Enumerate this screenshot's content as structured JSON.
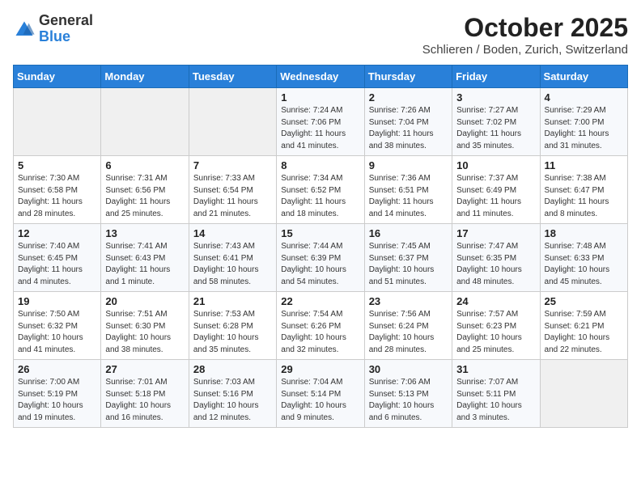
{
  "header": {
    "logo_general": "General",
    "logo_blue": "Blue",
    "title": "October 2025",
    "subtitle": "Schlieren / Boden, Zurich, Switzerland"
  },
  "calendar": {
    "days_of_week": [
      "Sunday",
      "Monday",
      "Tuesday",
      "Wednesday",
      "Thursday",
      "Friday",
      "Saturday"
    ],
    "weeks": [
      [
        {
          "day": "",
          "info": ""
        },
        {
          "day": "",
          "info": ""
        },
        {
          "day": "",
          "info": ""
        },
        {
          "day": "1",
          "info": "Sunrise: 7:24 AM\nSunset: 7:06 PM\nDaylight: 11 hours and 41 minutes."
        },
        {
          "day": "2",
          "info": "Sunrise: 7:26 AM\nSunset: 7:04 PM\nDaylight: 11 hours and 38 minutes."
        },
        {
          "day": "3",
          "info": "Sunrise: 7:27 AM\nSunset: 7:02 PM\nDaylight: 11 hours and 35 minutes."
        },
        {
          "day": "4",
          "info": "Sunrise: 7:29 AM\nSunset: 7:00 PM\nDaylight: 11 hours and 31 minutes."
        }
      ],
      [
        {
          "day": "5",
          "info": "Sunrise: 7:30 AM\nSunset: 6:58 PM\nDaylight: 11 hours and 28 minutes."
        },
        {
          "day": "6",
          "info": "Sunrise: 7:31 AM\nSunset: 6:56 PM\nDaylight: 11 hours and 25 minutes."
        },
        {
          "day": "7",
          "info": "Sunrise: 7:33 AM\nSunset: 6:54 PM\nDaylight: 11 hours and 21 minutes."
        },
        {
          "day": "8",
          "info": "Sunrise: 7:34 AM\nSunset: 6:52 PM\nDaylight: 11 hours and 18 minutes."
        },
        {
          "day": "9",
          "info": "Sunrise: 7:36 AM\nSunset: 6:51 PM\nDaylight: 11 hours and 14 minutes."
        },
        {
          "day": "10",
          "info": "Sunrise: 7:37 AM\nSunset: 6:49 PM\nDaylight: 11 hours and 11 minutes."
        },
        {
          "day": "11",
          "info": "Sunrise: 7:38 AM\nSunset: 6:47 PM\nDaylight: 11 hours and 8 minutes."
        }
      ],
      [
        {
          "day": "12",
          "info": "Sunrise: 7:40 AM\nSunset: 6:45 PM\nDaylight: 11 hours and 4 minutes."
        },
        {
          "day": "13",
          "info": "Sunrise: 7:41 AM\nSunset: 6:43 PM\nDaylight: 11 hours and 1 minute."
        },
        {
          "day": "14",
          "info": "Sunrise: 7:43 AM\nSunset: 6:41 PM\nDaylight: 10 hours and 58 minutes."
        },
        {
          "day": "15",
          "info": "Sunrise: 7:44 AM\nSunset: 6:39 PM\nDaylight: 10 hours and 54 minutes."
        },
        {
          "day": "16",
          "info": "Sunrise: 7:45 AM\nSunset: 6:37 PM\nDaylight: 10 hours and 51 minutes."
        },
        {
          "day": "17",
          "info": "Sunrise: 7:47 AM\nSunset: 6:35 PM\nDaylight: 10 hours and 48 minutes."
        },
        {
          "day": "18",
          "info": "Sunrise: 7:48 AM\nSunset: 6:33 PM\nDaylight: 10 hours and 45 minutes."
        }
      ],
      [
        {
          "day": "19",
          "info": "Sunrise: 7:50 AM\nSunset: 6:32 PM\nDaylight: 10 hours and 41 minutes."
        },
        {
          "day": "20",
          "info": "Sunrise: 7:51 AM\nSunset: 6:30 PM\nDaylight: 10 hours and 38 minutes."
        },
        {
          "day": "21",
          "info": "Sunrise: 7:53 AM\nSunset: 6:28 PM\nDaylight: 10 hours and 35 minutes."
        },
        {
          "day": "22",
          "info": "Sunrise: 7:54 AM\nSunset: 6:26 PM\nDaylight: 10 hours and 32 minutes."
        },
        {
          "day": "23",
          "info": "Sunrise: 7:56 AM\nSunset: 6:24 PM\nDaylight: 10 hours and 28 minutes."
        },
        {
          "day": "24",
          "info": "Sunrise: 7:57 AM\nSunset: 6:23 PM\nDaylight: 10 hours and 25 minutes."
        },
        {
          "day": "25",
          "info": "Sunrise: 7:59 AM\nSunset: 6:21 PM\nDaylight: 10 hours and 22 minutes."
        }
      ],
      [
        {
          "day": "26",
          "info": "Sunrise: 7:00 AM\nSunset: 5:19 PM\nDaylight: 10 hours and 19 minutes."
        },
        {
          "day": "27",
          "info": "Sunrise: 7:01 AM\nSunset: 5:18 PM\nDaylight: 10 hours and 16 minutes."
        },
        {
          "day": "28",
          "info": "Sunrise: 7:03 AM\nSunset: 5:16 PM\nDaylight: 10 hours and 12 minutes."
        },
        {
          "day": "29",
          "info": "Sunrise: 7:04 AM\nSunset: 5:14 PM\nDaylight: 10 hours and 9 minutes."
        },
        {
          "day": "30",
          "info": "Sunrise: 7:06 AM\nSunset: 5:13 PM\nDaylight: 10 hours and 6 minutes."
        },
        {
          "day": "31",
          "info": "Sunrise: 7:07 AM\nSunset: 5:11 PM\nDaylight: 10 hours and 3 minutes."
        },
        {
          "day": "",
          "info": ""
        }
      ]
    ]
  }
}
